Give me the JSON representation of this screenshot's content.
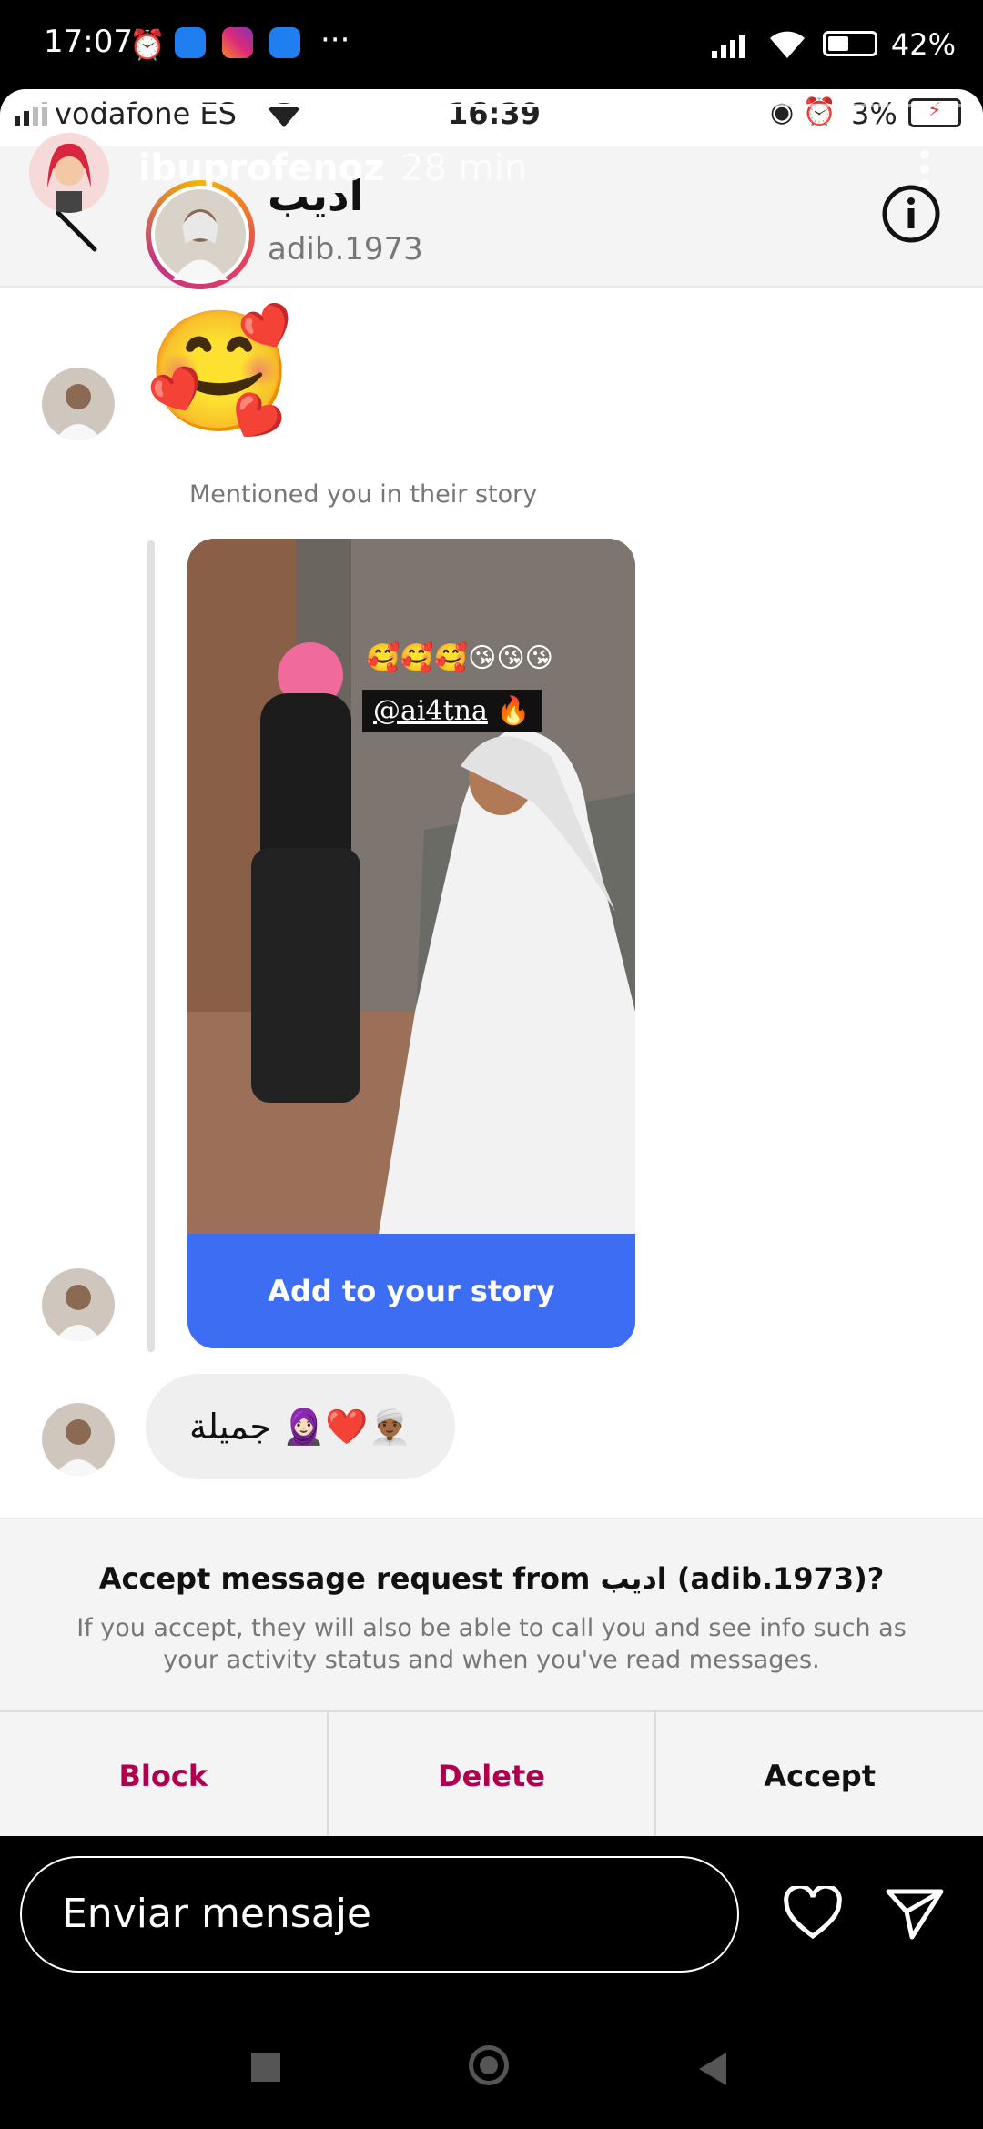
{
  "system_status": {
    "time": "17:07",
    "battery": "42%",
    "overflow_dots": "···"
  },
  "inner_status": {
    "carrier": "vodafone ES",
    "clock": "16:39",
    "battery": "3%"
  },
  "story_overlay": {
    "author": "ibuprofenoz",
    "time_ago": "28 min",
    "progress_fraction": 0.73
  },
  "chat_header": {
    "name": "اديب",
    "username": "adib.1973"
  },
  "messages": [
    {
      "type": "emoji",
      "content": "🥰"
    },
    {
      "type": "story_mention",
      "label": "Mentioned you in their story",
      "tag": "@ai4tna",
      "cta": "Add to your story",
      "emoji_row": "🥰🥰🥰😘😘😘",
      "fire": "🔥"
    },
    {
      "type": "text",
      "content": "جميلة 🧕🏻❤️👳🏾‍♂️"
    }
  ],
  "request": {
    "title": "Accept message request from اديب (adib.1973)?",
    "description": "If you accept, they will also be able to call you and see info such as your activity status and when you've read messages.",
    "actions": [
      {
        "label": "Block",
        "color": "#b0004d"
      },
      {
        "label": "Delete",
        "color": "#b0004d"
      },
      {
        "label": "Accept",
        "color": "#111111"
      }
    ]
  },
  "reply": {
    "placeholder": "Enviar mensaje"
  }
}
